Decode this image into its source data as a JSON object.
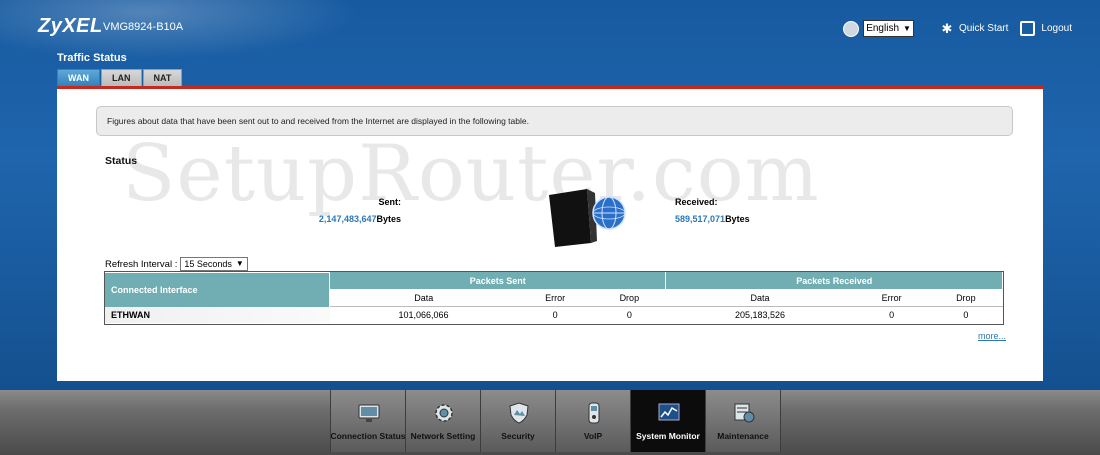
{
  "header": {
    "brand": "ZyXEL",
    "model": "VMG8924-B10A",
    "language": "English",
    "quick_start": "Quick Start",
    "logout": "Logout",
    "page_title": "Traffic Status"
  },
  "tabs": [
    {
      "label": "WAN",
      "active": true
    },
    {
      "label": "LAN",
      "active": false
    },
    {
      "label": "NAT",
      "active": false
    }
  ],
  "info_text": "Figures about data that have been sent out to and received from the Internet are displayed in the following table.",
  "watermark": "SetupRouter.com",
  "status": {
    "heading": "Status",
    "sent_label": "Sent:",
    "sent_value": "2,147,483,647",
    "sent_unit": "Bytes",
    "received_label": "Received:",
    "received_value": "589,517,071",
    "received_unit": "Bytes"
  },
  "refresh": {
    "label": "Refresh Interval :",
    "value": "15 Seconds"
  },
  "table": {
    "connected_interface": "Connected Interface",
    "packets_sent": "Packets Sent",
    "packets_received": "Packets Received",
    "sub_headers": [
      "Data",
      "Error",
      "Drop",
      "Data",
      "Error",
      "Drop"
    ],
    "rows": [
      {
        "interface": "ETHWAN",
        "values": [
          "101,066,066",
          "0",
          "0",
          "205,183,526",
          "0",
          "0"
        ]
      }
    ]
  },
  "more_link": "more...",
  "nav": [
    {
      "label": "Connection Status",
      "icon": "monitor-icon",
      "active": false
    },
    {
      "label": "Network Setting",
      "icon": "gear-icon",
      "active": false
    },
    {
      "label": "Security",
      "icon": "shield-icon",
      "active": false
    },
    {
      "label": "VoIP",
      "icon": "phone-icon",
      "active": false
    },
    {
      "label": "System Monitor",
      "icon": "chart-icon",
      "active": true
    },
    {
      "label": "Maintenance",
      "icon": "tools-icon",
      "active": false
    }
  ],
  "colors": {
    "header_blue": "#1f65ad",
    "accent_red": "#c8281e",
    "table_teal": "#71aeb3",
    "link_blue": "#2a78b7"
  }
}
